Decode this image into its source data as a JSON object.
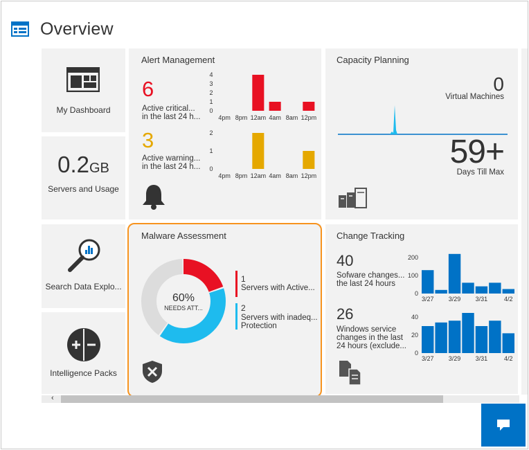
{
  "header": {
    "title": "Overview",
    "icon": "overview-icon"
  },
  "tiles": {
    "my_dashboard": {
      "label": "My Dashboard",
      "icon": "dashboard-icon"
    },
    "usage": {
      "value": "0.2",
      "unit": "GB",
      "label": "Servers and Usage"
    },
    "search": {
      "label": "Search Data Explo...",
      "icon": "search-chart-icon"
    },
    "intelligence": {
      "label": "Intelligence Packs",
      "icon": "plus-minus-icon"
    }
  },
  "alert": {
    "title": "Alert Management",
    "critical": {
      "count": "6",
      "line1": "Active critical...",
      "line2": "in the last 24 h...",
      "color": "#e81123"
    },
    "warning": {
      "count": "3",
      "line1": "Active warning...",
      "line2": "in the last 24 h...",
      "color": "#e5a800"
    },
    "critical_chart": {
      "ticks": [
        "4",
        "3",
        "2",
        "1",
        "0"
      ],
      "xlabels": [
        "4pm",
        "8pm",
        "12am",
        "4am",
        "8am",
        "12pm"
      ],
      "values": [
        0,
        0,
        4,
        1,
        0,
        1
      ],
      "ymax": 4
    },
    "warning_chart": {
      "ticks": [
        "2",
        "1",
        "0"
      ],
      "xlabels": [
        "4pm",
        "8pm",
        "12am",
        "4am",
        "8am",
        "12pm"
      ],
      "values": [
        0,
        0,
        2,
        0,
        0,
        1
      ],
      "ymax": 2
    },
    "icon": "bell-icon"
  },
  "capacity": {
    "title": "Capacity Planning",
    "vm_count": "0",
    "vm_label": "Virtual Machines",
    "days_value": "59+",
    "days_label": "Days Till Max",
    "icon": "servers-icon"
  },
  "malware": {
    "title": "Malware Assessment",
    "percent": "60%",
    "needs": "NEEDS ATT...",
    "legend": [
      {
        "count": "1",
        "line1": "Servers with Active...",
        "line2": "",
        "color": "#e81123"
      },
      {
        "count": "2",
        "line1": "Servers with inadeq...",
        "line2": "Protection",
        "color": "#1ebbee"
      }
    ],
    "donut": {
      "red_fraction": 0.2,
      "blue_fraction": 0.4,
      "gray_fraction": 0.4
    },
    "icon": "shield-x-icon"
  },
  "change": {
    "title": "Change Tracking",
    "software": {
      "count": "40",
      "line1": "Sofware changes...",
      "line2": "the last 24 hours"
    },
    "services": {
      "count": "26",
      "line1": "Windows service",
      "line2": "changes in the last",
      "line3": "24 hours (exclude..."
    },
    "software_chart": {
      "ticks": [
        "200",
        "100",
        "0"
      ],
      "xlabels": [
        "3/27",
        "3/29",
        "3/31",
        "4/2"
      ],
      "values": [
        130,
        20,
        220,
        60,
        40,
        60,
        25
      ],
      "ymax": 200
    },
    "services_chart": {
      "ticks": [
        "40",
        "20",
        "0"
      ],
      "xlabels": [
        "3/27",
        "3/29",
        "3/31",
        "4/2"
      ],
      "values": [
        30,
        34,
        36,
        45,
        30,
        36,
        22
      ],
      "ymax": 40
    },
    "icon": "change-files-icon"
  },
  "colors": {
    "blue": "#0072c6",
    "red": "#e81123",
    "yellow": "#e5a800",
    "cyan": "#1ebbee",
    "tile": "#f2f2f2",
    "orange": "#f7931e"
  },
  "chat_icon": "chat-icon"
}
